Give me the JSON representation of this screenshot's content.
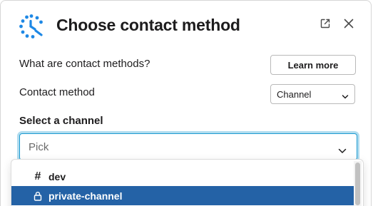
{
  "modal": {
    "title": "Choose contact method"
  },
  "rows": {
    "question_label": "What are contact methods?",
    "learn_more_label": "Learn more",
    "contact_method_label": "Contact method",
    "contact_method_value": "Channel"
  },
  "channel": {
    "section_label": "Select a channel",
    "placeholder": "Pick",
    "options": [
      {
        "label": "dev",
        "icon": "hash-icon",
        "selected": false
      },
      {
        "label": "private-channel",
        "icon": "lock-icon",
        "selected": true
      }
    ]
  },
  "colors": {
    "accent_focus": "#1d9bd1",
    "highlight": "#2462a6",
    "logo_blue": "#1e88e5"
  }
}
